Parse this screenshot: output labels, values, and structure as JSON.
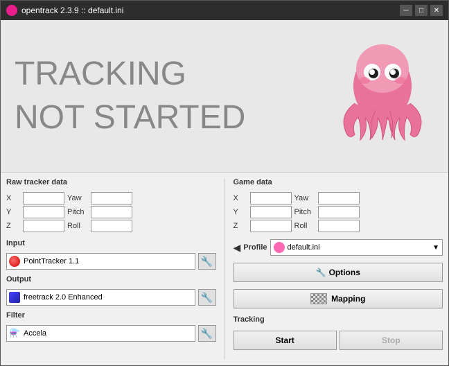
{
  "window": {
    "title": "opentrack 2.3.9 :: default.ini",
    "buttons": {
      "minimize": "─",
      "maximize": "□",
      "close": "✕"
    }
  },
  "tracking_status": {
    "line1": "TRACKING",
    "line2": "NOT STARTED"
  },
  "left_panel": {
    "raw_tracker_label": "Raw tracker data",
    "axes": [
      {
        "label": "X",
        "second_label": "Yaw"
      },
      {
        "label": "Y",
        "second_label": "Pitch"
      },
      {
        "label": "Z",
        "second_label": "Roll"
      }
    ]
  },
  "right_panel": {
    "game_data_label": "Game data",
    "axes": [
      {
        "label": "X",
        "second_label": "Yaw"
      },
      {
        "label": "Y",
        "second_label": "Pitch"
      },
      {
        "label": "Z",
        "second_label": "Roll"
      }
    ],
    "profile_label": "Profile",
    "profile_value": "default.ini",
    "options_label": "Options",
    "mapping_label": "Mapping",
    "tracking_label": "Tracking",
    "start_label": "Start",
    "stop_label": "Stop"
  },
  "input": {
    "label": "Input",
    "value": "PointTracker 1.1"
  },
  "output": {
    "label": "Output",
    "value": "freetrack 2.0 Enhanced"
  },
  "filter": {
    "label": "Filter",
    "value": "Accela"
  }
}
